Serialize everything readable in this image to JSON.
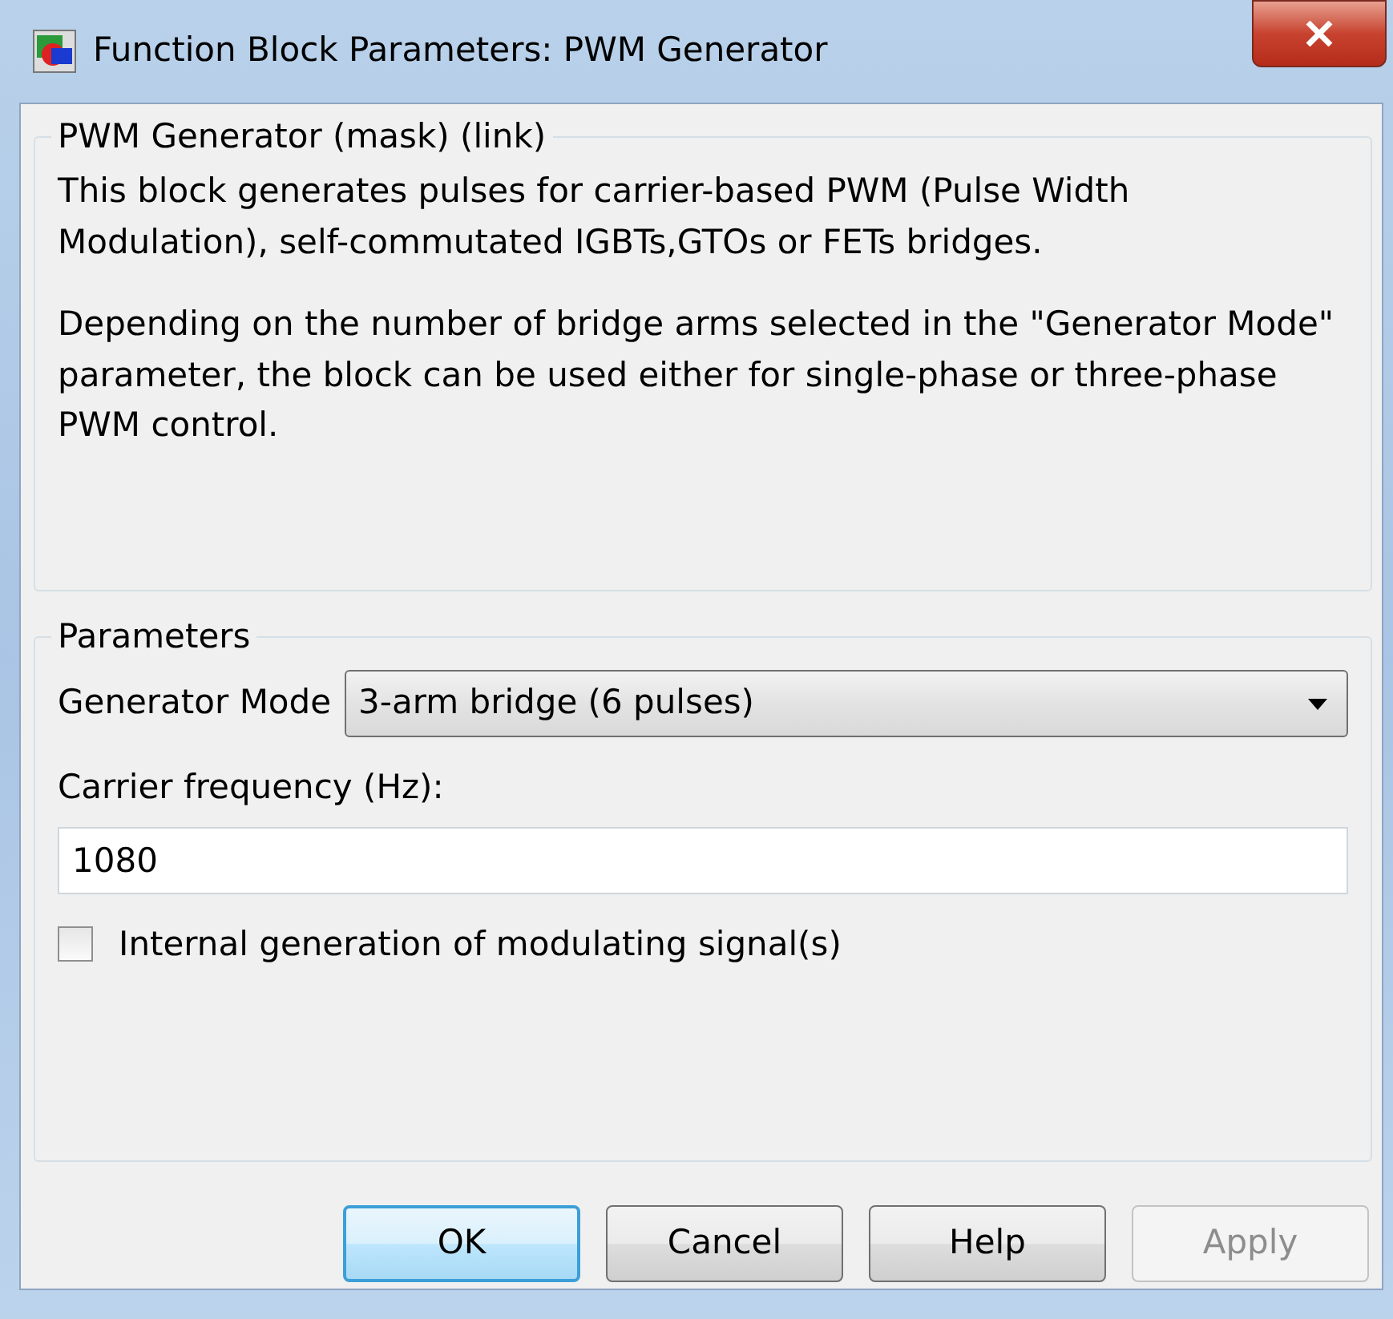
{
  "window": {
    "title": "Function Block Parameters: PWM Generator"
  },
  "description": {
    "title": "PWM Generator (mask) (link)",
    "paragraphs": [
      "This block generates pulses for carrier-based PWM (Pulse Width Modulation), self-commutated IGBTs,GTOs or FETs bridges.",
      "Depending on the number of bridge arms selected in the \"Generator Mode\" parameter, the block can be used either for single-phase or three-phase PWM control."
    ]
  },
  "parameters": {
    "title": "Parameters",
    "fields": [
      {
        "kind": "dropdown",
        "label": "Generator Mode",
        "value": "3-arm  bridge (6 pulses)"
      },
      {
        "kind": "text",
        "label": "Carrier frequency (Hz):",
        "value": "1080"
      },
      {
        "kind": "checkbox",
        "label": "Internal generation of modulating signal(s)",
        "checked": false
      }
    ]
  },
  "buttons": [
    {
      "label": "OK",
      "default": true,
      "disabled": false
    },
    {
      "label": "Cancel",
      "default": false,
      "disabled": false
    },
    {
      "label": "Help",
      "default": false,
      "disabled": false
    },
    {
      "label": "Apply",
      "default": false,
      "disabled": true
    }
  ]
}
